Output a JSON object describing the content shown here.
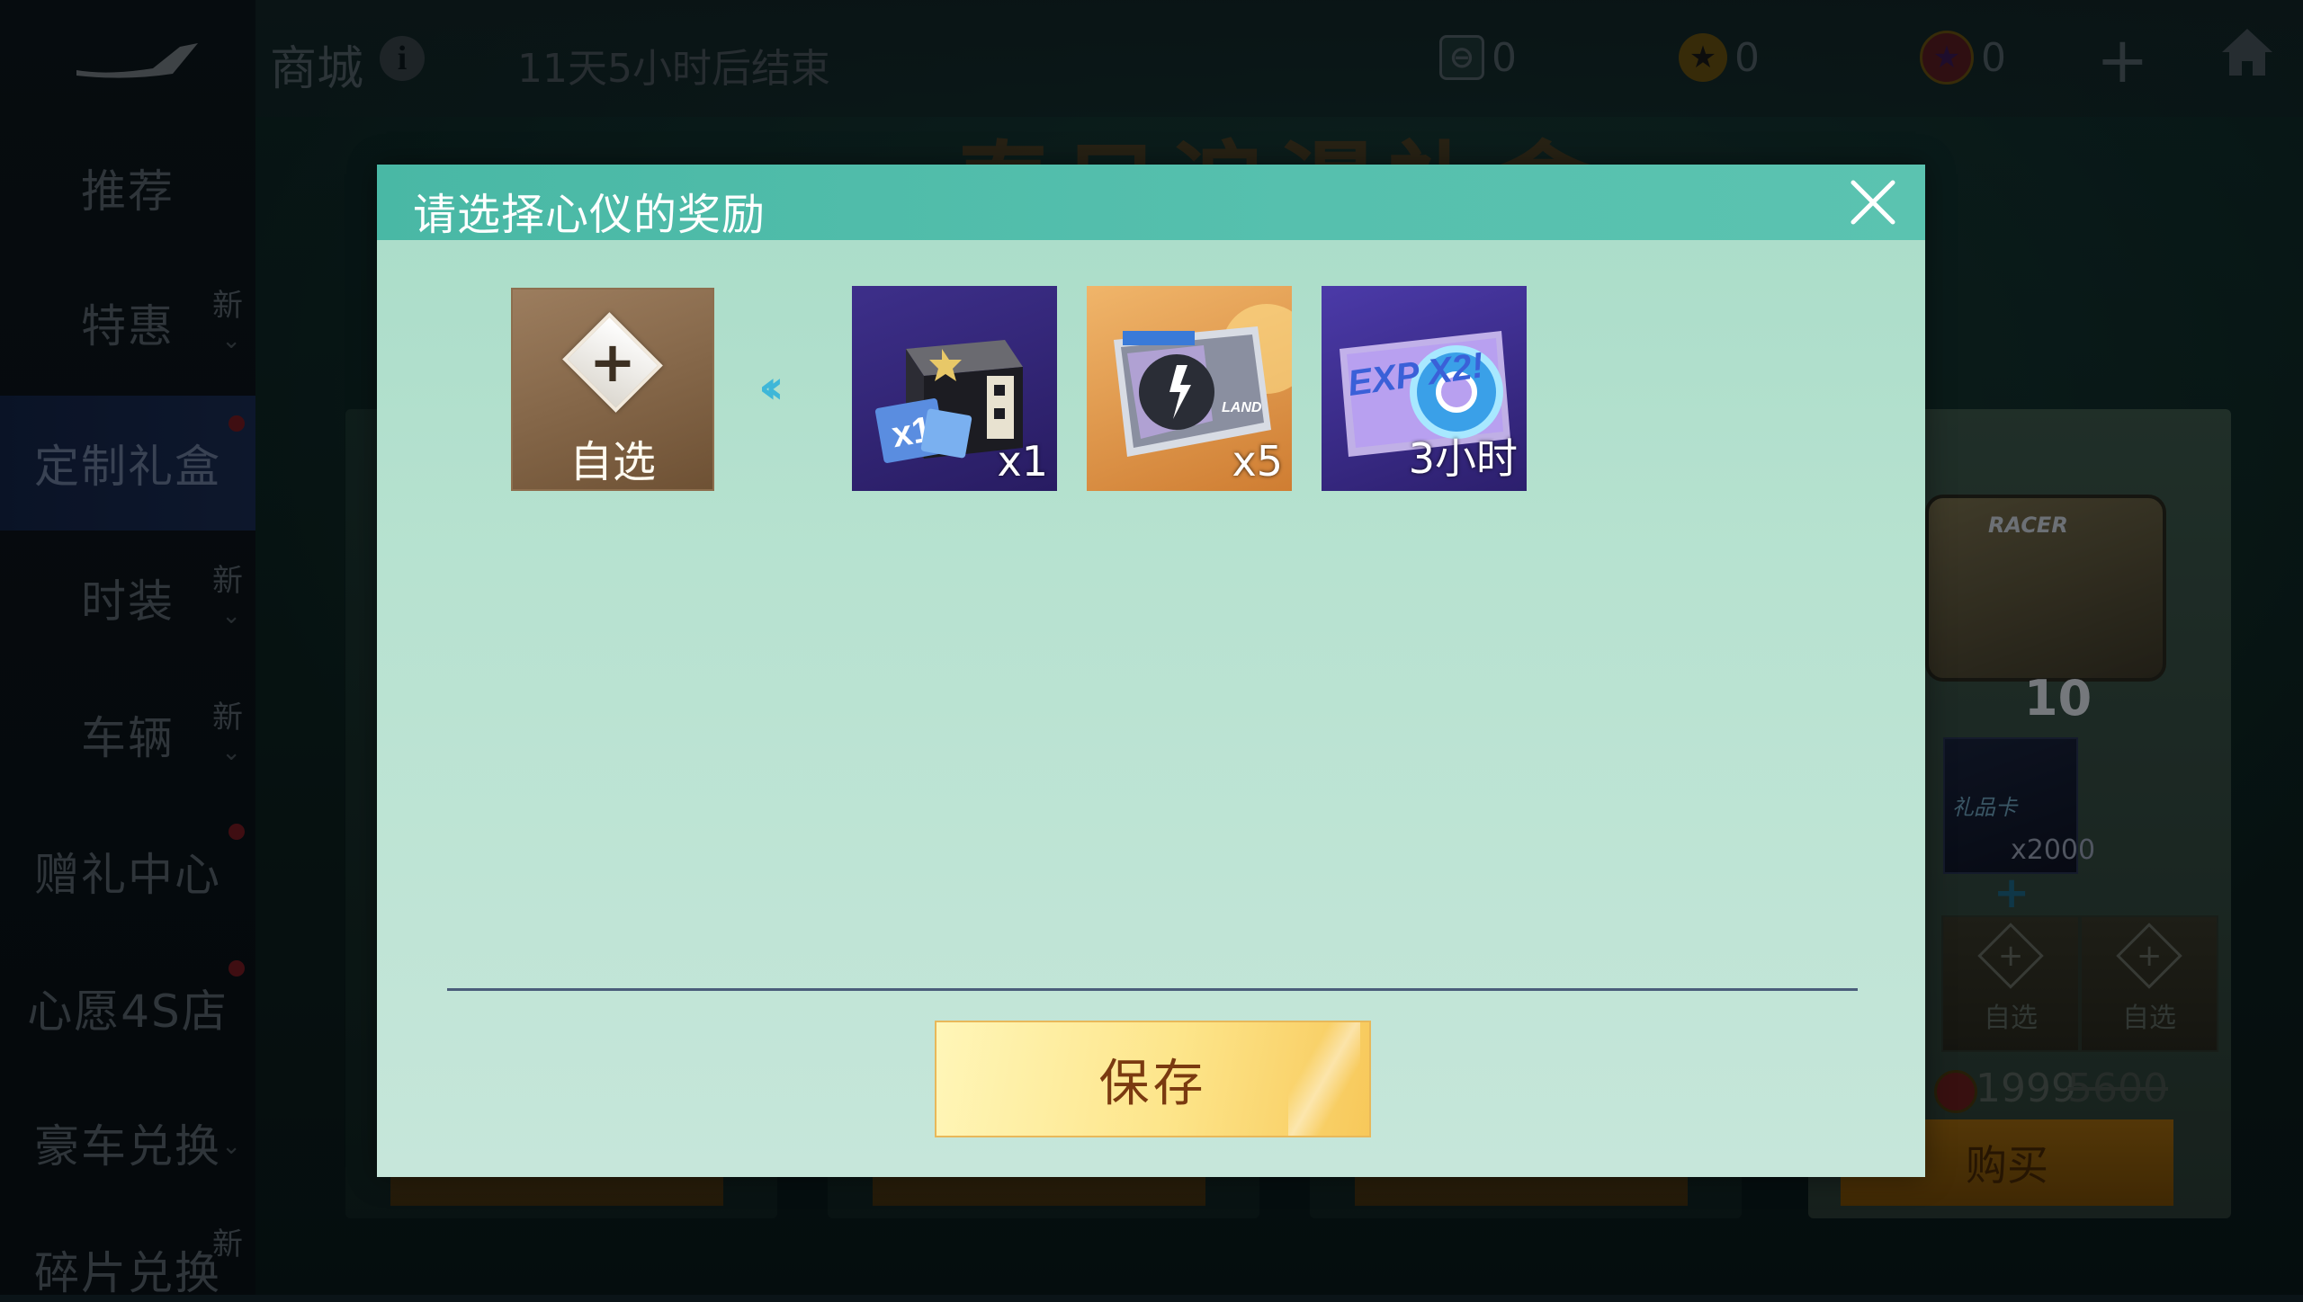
{
  "topbar": {
    "title": "商城",
    "countdown": "11天5小时后结束",
    "currencies": [
      {
        "icon": "ticket-icon",
        "value": "0"
      },
      {
        "icon": "star-coin-icon",
        "value": "0"
      },
      {
        "icon": "gem-coin-icon",
        "value": "0"
      }
    ]
  },
  "banner": {
    "text": "春日浪漫礼盒"
  },
  "sidebar": {
    "items": [
      {
        "label": "推荐",
        "new": "",
        "dot": false
      },
      {
        "label": "特惠",
        "new": "新",
        "dot": false
      },
      {
        "label": "定制礼盒",
        "new": "",
        "dot": true
      },
      {
        "label": "时装",
        "new": "新",
        "dot": false
      },
      {
        "label": "车辆",
        "new": "新",
        "dot": false
      },
      {
        "label": "赠礼中心",
        "new": "",
        "dot": true
      },
      {
        "label": "心愿4S店",
        "new": "",
        "dot": true
      },
      {
        "label": "豪车兑换",
        "new": "",
        "dot": false
      },
      {
        "label": "碎片兑换",
        "new": "新",
        "dot": false
      }
    ]
  },
  "background_card": {
    "chest_label": "RACER",
    "chest_count": "10",
    "giftcard_label": "礼品卡",
    "giftcard_qty": "x2000",
    "slot_label": "自选",
    "price_current": "1999",
    "price_original": "5600",
    "buy_label": "购买"
  },
  "dialog": {
    "title": "请选择心仪的奖励",
    "self_select_label": "自选",
    "rewards": [
      {
        "name": "mystery-box",
        "qty": "x1"
      },
      {
        "name": "land-card",
        "qty": "x5"
      },
      {
        "name": "exp-double-card",
        "qty": "3小时",
        "badge": "EXP X2!"
      }
    ],
    "save_label": "保存"
  },
  "colors": {
    "header": "#4fbcaa",
    "panel": "#b7e2d0",
    "save_button": "#fde58a",
    "arrow": "#3fb7d8"
  }
}
